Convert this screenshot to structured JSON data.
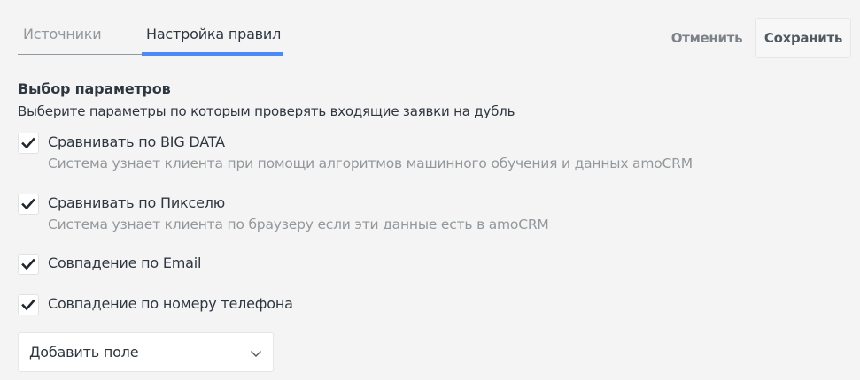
{
  "tabs": [
    {
      "label": "Источники"
    },
    {
      "label": "Настройка правил"
    }
  ],
  "header": {
    "cancel_label": "Отменить",
    "save_label": "Сохранить"
  },
  "section": {
    "title": "Выбор параметров",
    "description": "Выберите параметры по которым проверять входящие заявки на дубль"
  },
  "options": [
    {
      "label": "Сравнивать по BIG DATA",
      "hint": "Система узнает клиента при помощи алгоритмов машинного обучения и данных amoCRM",
      "checked": true
    },
    {
      "label": "Сравнивать по Пикселю",
      "hint": "Система узнает клиента по браузеру если эти данные есть в amoCRM",
      "checked": true
    },
    {
      "label": "Совпадение по Email",
      "checked": true
    },
    {
      "label": "Совпадение по номеру телефона",
      "checked": true
    }
  ],
  "add_field": {
    "label": "Добавить поле",
    "icon": "chevron-down-icon"
  },
  "colors": {
    "accent": "#4c8bf7",
    "text": "#2e3640",
    "muted": "#92989b",
    "background": "#f4f4f4"
  }
}
